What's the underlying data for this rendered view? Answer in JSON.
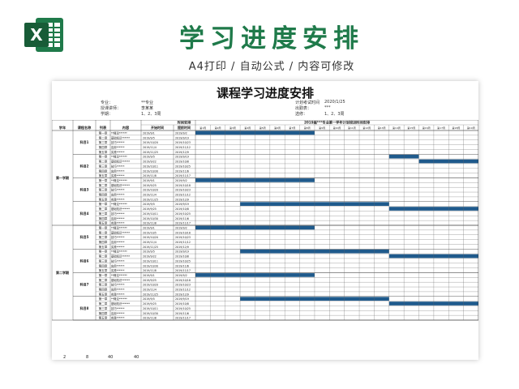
{
  "banner": {
    "title": "学习进度安排",
    "subtitle": "A4打印 / 自动公式 / 内容可修改",
    "logo_letter": "X"
  },
  "colors": {
    "accent": "#1f7a4a",
    "bar": "#1f5a8c",
    "banner_title": "#1f7a4a"
  },
  "doc": {
    "title": "课程学习进度安排",
    "info_left": [
      {
        "label": "专业：",
        "value": "**专业"
      },
      {
        "label": "授课讲师：",
        "value": "李某某"
      },
      {
        "label": "学期：",
        "value": "1、2、3周"
      }
    ],
    "info_right": [
      {
        "label": "计划考试时间",
        "value": "2020/1/25"
      },
      {
        "label": "出勤表：",
        "value": "***"
      },
      {
        "label": "选修：",
        "value": "1、2、3周"
      }
    ]
  },
  "table": {
    "headers": {
      "semester": "学年",
      "course_name": "课程名称",
      "column": "列表",
      "content": "内容",
      "time_group": "时间安排",
      "start": "开始时间",
      "end": "提前时间",
      "plan_group": "2019届***专业第一学年计划培训时间安排"
    },
    "weeks": [
      "第1周",
      "第2周",
      "第3周",
      "第4周",
      "第5周",
      "第6周",
      "第7周",
      "第8周",
      "第9周",
      "第10周",
      "第11周",
      "第12周",
      "第13周",
      "第14周",
      "第15周",
      "第16周",
      "第17周",
      "第18周",
      "第19周"
    ],
    "semesters": [
      {
        "label": "第一学期",
        "subjects": [
          {
            "name": "科目1",
            "rows": [
              {
                "chapter": "第一章",
                "content": "**概论******",
                "start": "2019/9/1",
                "end": "2019/9/2",
                "bar": [
                  0,
                  8
                ]
              },
              {
                "chapter": "第二章",
                "content": "基础知识******",
                "start": "2019/9/5",
                "end": "2019/9/19",
                "bar": null
              },
              {
                "chapter": "第三章",
                "content": "技巧******",
                "start": "2019/10/20",
                "end": "2019/10/23",
                "bar": null
              },
              {
                "chapter": "第四章",
                "content": "应用******",
                "start": "2019/11/4",
                "end": "2019/11/12",
                "bar": null
              },
              {
                "chapter": "第五章",
                "content": "实践******",
                "start": "2019/11/25",
                "end": "2019/12/9",
                "bar": null
              }
            ]
          },
          {
            "name": "科目2",
            "rows": [
              {
                "chapter": "第一章",
                "content": "**概论******",
                "start": "2019/9/5",
                "end": "2019/9/19",
                "bar": [
                  13,
                  15
                ]
              },
              {
                "chapter": "第二章",
                "content": "基础知识******",
                "start": "2019/9/22",
                "end": "2019/10/8",
                "bar": [
                  15,
                  19
                ]
              },
              {
                "chapter": "第三章",
                "content": "技巧******",
                "start": "2019/10/11",
                "end": "2019/10/25",
                "bar": null
              },
              {
                "chapter": "第四章",
                "content": "应用******",
                "start": "2019/10/30",
                "end": "2019/11/6",
                "bar": null
              },
              {
                "chapter": "第五章",
                "content": "实践******",
                "start": "2019/11/8",
                "end": "2019/11/17",
                "bar": null
              }
            ]
          },
          {
            "name": "科目3",
            "rows": [
              {
                "chapter": "第一章",
                "content": "**概论******",
                "start": "2019/9/1",
                "end": "2019/9/2",
                "bar": [
                  0,
                  8
                ]
              },
              {
                "chapter": "第二章",
                "content": "基础知识******",
                "start": "2019/9/25",
                "end": "2019/10/18",
                "bar": null
              },
              {
                "chapter": "第三章",
                "content": "技巧******",
                "start": "2019/10/20",
                "end": "2019/10/23",
                "bar": null
              },
              {
                "chapter": "第四章",
                "content": "应用******",
                "start": "2019/11/4",
                "end": "2019/11/12",
                "bar": null
              },
              {
                "chapter": "第五章",
                "content": "实践******",
                "start": "2019/11/25",
                "end": "2019/12/9",
                "bar": null
              }
            ]
          },
          {
            "name": "科目4",
            "rows": [
              {
                "chapter": "第一章",
                "content": "**概论******",
                "start": "2019/9/5",
                "end": "2019/9/19",
                "bar": [
                  3,
                  13
                ]
              },
              {
                "chapter": "第二章",
                "content": "基础知识******",
                "start": "2019/9/25",
                "end": "2019/10/8",
                "bar": [
                  13,
                  19
                ]
              },
              {
                "chapter": "第三章",
                "content": "技巧******",
                "start": "2019/10/11",
                "end": "2019/10/25",
                "bar": null
              },
              {
                "chapter": "第四章",
                "content": "应用******",
                "start": "2019/10/30",
                "end": "2019/11/6",
                "bar": null
              },
              {
                "chapter": "第五章",
                "content": "实践******",
                "start": "2019/11/8",
                "end": "2019/11/17",
                "bar": null
              }
            ]
          }
        ]
      },
      {
        "label": "第二学期",
        "subjects": [
          {
            "name": "科目5",
            "rows": [
              {
                "chapter": "第一章",
                "content": "**概论******",
                "start": "2019/9/1",
                "end": "2019/9/2",
                "bar": [
                  0,
                  8
                ]
              },
              {
                "chapter": "第二章",
                "content": "基础知识******",
                "start": "2019/10/5",
                "end": "2019/10/18",
                "bar": null
              },
              {
                "chapter": "第三章",
                "content": "技巧******",
                "start": "2019/10/20",
                "end": "2019/10/23",
                "bar": null
              },
              {
                "chapter": "第四章",
                "content": "应用******",
                "start": "2019/11/4",
                "end": "2019/11/12",
                "bar": null
              },
              {
                "chapter": "第五章",
                "content": "实践******",
                "start": "2019/11/25",
                "end": "2019/12/9",
                "bar": null
              }
            ]
          },
          {
            "name": "科目6",
            "rows": [
              {
                "chapter": "第一章",
                "content": "**概论******",
                "start": "2019/9/5",
                "end": "2019/9/19",
                "bar": [
                  3,
                  13
                ]
              },
              {
                "chapter": "第二章",
                "content": "基础知识******",
                "start": "2019/9/22",
                "end": "2019/10/8",
                "bar": [
                  13,
                  19
                ]
              },
              {
                "chapter": "第三章",
                "content": "技巧******",
                "start": "2019/10/11",
                "end": "2019/10/25",
                "bar": null
              },
              {
                "chapter": "第四章",
                "content": "应用******",
                "start": "2019/10/30",
                "end": "2019/11/6",
                "bar": null
              },
              {
                "chapter": "第五章",
                "content": "实践******",
                "start": "2019/11/8",
                "end": "2019/11/17",
                "bar": null
              }
            ]
          },
          {
            "name": "科目7",
            "rows": [
              {
                "chapter": "第一章",
                "content": "**概论******",
                "start": "2019/9/1",
                "end": "2019/9/2",
                "bar": [
                  0,
                  8
                ]
              },
              {
                "chapter": "第二章",
                "content": "基础知识******",
                "start": "2019/9/25",
                "end": "2019/10/18",
                "bar": null
              },
              {
                "chapter": "第三章",
                "content": "技巧******",
                "start": "2019/10/20",
                "end": "2019/10/23",
                "bar": null
              },
              {
                "chapter": "第四章",
                "content": "应用******",
                "start": "2019/11/4",
                "end": "2019/11/12",
                "bar": null
              },
              {
                "chapter": "第五章",
                "content": "实践******",
                "start": "2019/11/25",
                "end": "2019/12/9",
                "bar": null
              }
            ]
          },
          {
            "name": "科目8",
            "rows": [
              {
                "chapter": "第一章",
                "content": "**概论******",
                "start": "2019/9/5",
                "end": "2019/9/19",
                "bar": [
                  3,
                  13
                ]
              },
              {
                "chapter": "第二章",
                "content": "基础知识******",
                "start": "2019/9/25",
                "end": "2019/10/8",
                "bar": [
                  13,
                  19
                ]
              },
              {
                "chapter": "第三章",
                "content": "技巧******",
                "start": "2019/10/11",
                "end": "2019/10/25",
                "bar": null
              },
              {
                "chapter": "第四章",
                "content": "应用******",
                "start": "2019/10/30",
                "end": "2019/11/6",
                "bar": null
              },
              {
                "chapter": "第五章",
                "content": "实践******",
                "start": "2019/11/8",
                "end": "2019/11/17",
                "bar": null
              }
            ]
          }
        ]
      }
    ],
    "footer": [
      "2",
      "8",
      "40",
      "40"
    ]
  }
}
